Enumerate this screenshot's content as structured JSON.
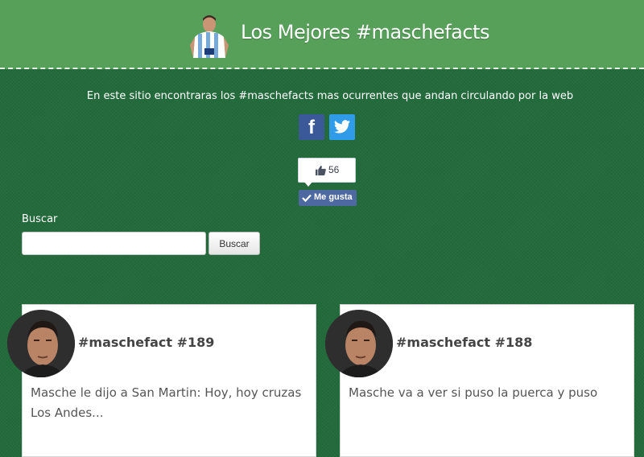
{
  "header": {
    "title": "Los Mejores #maschefacts",
    "logo_icon": "player-argentina-jersey-icon",
    "bg_color": "#57a05a"
  },
  "intro": {
    "text": "En este sitio encontraras los #maschefacts mas ocurrentes que andan circulando por la web"
  },
  "social": {
    "facebook": {
      "icon": "facebook-icon",
      "glyph": "f",
      "color": "#3b5998"
    },
    "twitter": {
      "icon": "twitter-icon",
      "color": "#2f9be9"
    }
  },
  "like": {
    "count": "56",
    "button_label": "Me gusta",
    "color": "#4e69a2"
  },
  "search": {
    "label": "Buscar",
    "value": "",
    "button_label": "Buscar"
  },
  "facts": [
    {
      "title": "#maschefact #189",
      "text": "Masche le dijo a San Martin: Hoy, hoy cruzas Los Andes..."
    },
    {
      "title": "#maschefact #188",
      "text": "Masche va a ver si puso la puerca y puso"
    }
  ],
  "colors": {
    "page_bg": "#236b3b",
    "card_bg": "#ffffff"
  }
}
